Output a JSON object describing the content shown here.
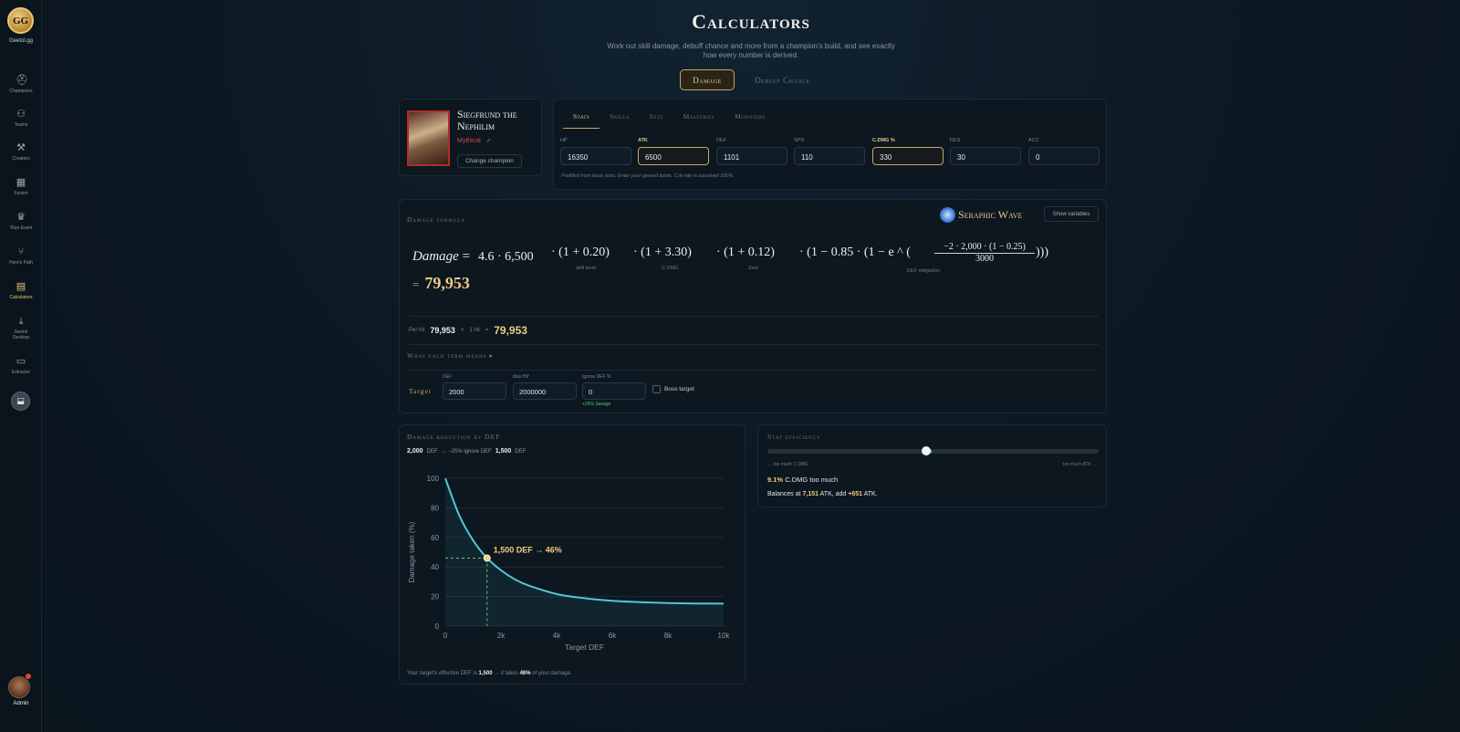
{
  "sidebar": {
    "logo_text": "Geetol.gg",
    "logo_mark": "GG",
    "items": [
      {
        "label": "Champions",
        "icon": "helmet-icon"
      },
      {
        "label": "Teams",
        "icon": "teams-icon"
      },
      {
        "label": "Creators",
        "icon": "tools-icon"
      },
      {
        "label": "Fusion",
        "icon": "calendar-icon"
      },
      {
        "label": "Titan Event",
        "icon": "crown-icon"
      },
      {
        "label": "Hero's Path",
        "icon": "path-icon"
      },
      {
        "label": "Calculators",
        "icon": "calculator-icon"
      },
      {
        "label": "Geetol Desktop",
        "icon": "download-icon"
      },
      {
        "label": "Extractor",
        "icon": "monitor-icon"
      }
    ],
    "active": "Calculators",
    "admin_label": "Admin"
  },
  "header": {
    "title": "Calculators",
    "subtitle": "Work out skill damage, debuff chance and more from a champion's build, and see exactly how every number is derived.",
    "tabs": [
      "Damage",
      "Debuff Chance"
    ],
    "active_tab": "Damage"
  },
  "champion": {
    "name": "Siegfrund the Nephilim",
    "rarity": "Mythical",
    "rarity_color": "#d24a4a",
    "affinity_icon": "magic-affinity-icon",
    "change_label": "Change champion"
  },
  "stats": {
    "tabs": [
      "Stats",
      "Skills",
      "Sets",
      "Masteries",
      "Modifiers"
    ],
    "active_tab": "Stats",
    "fields": [
      {
        "label": "HP",
        "value": "16350"
      },
      {
        "label": "ATK",
        "value": "6500"
      },
      {
        "label": "DEF",
        "value": "1101"
      },
      {
        "label": "SPD",
        "value": "110"
      },
      {
        "label": "C.DMG %",
        "value": "330"
      },
      {
        "label": "RES",
        "value": "30"
      },
      {
        "label": "ACC",
        "value": "0"
      }
    ],
    "note": "Prefilled from base stats. Enter your geared totals. Crit rate is assumed 100%."
  },
  "formula": {
    "section_label": "Damage formula",
    "skill_name": "Seraphic Wave",
    "show_variables": "Show variables",
    "lhs": "Damage",
    "multiplier": "4.6",
    "atk": "6,500",
    "terms": [
      {
        "expr": "(1 + 0.20)",
        "label": "skill level"
      },
      {
        "expr": "(1 + 3.30)",
        "label": "C.DMG"
      },
      {
        "expr": "(1 + 0.12)",
        "label": "Zeal"
      }
    ],
    "def_mitigation": {
      "prefix": "(1 − 0.85 · (1 − e ^ (",
      "numerator": "−2 · 2,000 · (1 − 0.25)",
      "denominator": "3000",
      "suffix": ")))",
      "label": "DEF mitigation"
    },
    "result": "79,953",
    "per_hit_label": "Per hit",
    "per_hit": "79,953",
    "hits": "1 hit",
    "total": "79,953",
    "what_each_term": "What each term means"
  },
  "target": {
    "label": "Target",
    "fields": [
      {
        "label": "DEF",
        "value": "2000"
      },
      {
        "label": "Max HP",
        "value": "2000000"
      },
      {
        "label": "Ignore DEF %",
        "value": "0",
        "note": "+25% Savage"
      }
    ],
    "boss_label": "Boss target"
  },
  "def_chart": {
    "section_label": "Damage reduction by DEF",
    "from_def": "2,000",
    "from_unit": "DEF",
    "arrow_text": "→ −25% ignore DEF",
    "to_def": "1,500",
    "to_unit": "DEF",
    "footer_pre": "Your target's effective DEF is",
    "footer_def": "1,500",
    "footer_mid": "→ it takes",
    "footer_pct": "46%",
    "footer_post": "of your damage."
  },
  "chart_data": {
    "type": "area",
    "xlabel": "Target DEF",
    "ylabel": "Damage taken (%)",
    "xlim": [
      0,
      10000
    ],
    "ylim": [
      0,
      100
    ],
    "x_ticks": [
      0,
      2000,
      4000,
      6000,
      8000,
      10000
    ],
    "x_tick_labels": [
      "0",
      "2k",
      "4k",
      "6k",
      "8k",
      "10k"
    ],
    "y_ticks": [
      0,
      20,
      40,
      60,
      80,
      100
    ],
    "x": [
      0,
      500,
      1000,
      1500,
      2000,
      2500,
      3000,
      4000,
      5000,
      6000,
      7000,
      8000,
      9000,
      10000
    ],
    "y": [
      100,
      75,
      58,
      46,
      37.8,
      31.6,
      27.4,
      21.7,
      18.9,
      17.1,
      16.2,
      15.6,
      15.3,
      15.2
    ],
    "marker": {
      "x": 1500,
      "y": 46,
      "label": "1,500 DEF → 46%"
    },
    "line_color": "#4fc9d6",
    "marker_color": "#f0c982",
    "grid": true
  },
  "efficiency": {
    "section_label": "Stat efficiency",
    "slider_fraction": 0.48,
    "left_label": "← too much C.DMG",
    "right_label": "too much ATK →",
    "pct": "9.1%",
    "stat": "C.DMG too much",
    "balance_pre": "Balances at",
    "balance_atk": "7,151",
    "balance_mid": "ATK, add",
    "balance_add": "+651",
    "balance_post": "ATK."
  }
}
